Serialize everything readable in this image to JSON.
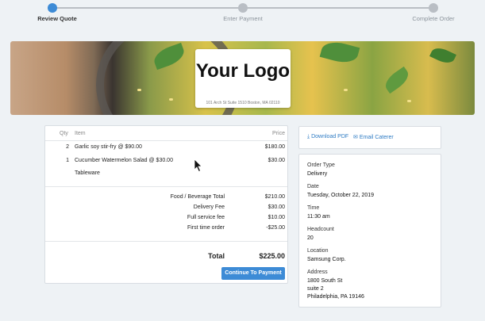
{
  "stepper": {
    "steps": [
      {
        "label": "Review Quote"
      },
      {
        "label": "Enter Payment"
      },
      {
        "label": "Complete Order"
      }
    ]
  },
  "hero": {
    "logo_text": "Your Logo",
    "address": "101 Arch St Suite 1510 Boston, MA 02110"
  },
  "quote": {
    "headers": {
      "qty": "Qty",
      "item": "Item",
      "price": "Price"
    },
    "items": [
      {
        "qty": "2",
        "item": "Garlic soy stir-fry @ $90.00",
        "price": "$180.00"
      },
      {
        "qty": "1",
        "item": "Cucumber Watermelon Salad @ $30.00",
        "price": "$30.00"
      },
      {
        "qty": "",
        "item": "Tableware",
        "price": ""
      }
    ],
    "fees": [
      {
        "label": "Food / Beverage Total",
        "value": "$210.00"
      },
      {
        "label": "Delivery Fee",
        "value": "$30.00"
      },
      {
        "label": "Full service fee",
        "value": "$10.00"
      },
      {
        "label": "First time order",
        "value": "-$25.00"
      }
    ],
    "total_label": "Total",
    "total_value": "$225.00",
    "continue_label": "Continue To Payment"
  },
  "actions": {
    "download_label": "Download PDF",
    "email_label": "Email Caterer"
  },
  "details": {
    "order_type": {
      "label": "Order Type",
      "value": "Delivery"
    },
    "date": {
      "label": "Date",
      "value": "Tuesday, October 22, 2019"
    },
    "time": {
      "label": "Time",
      "value": "11:30 am"
    },
    "headcount": {
      "label": "Headcount",
      "value": "20"
    },
    "location": {
      "label": "Location",
      "value": "Samsung Corp."
    },
    "address": {
      "label": "Address",
      "line1": "1800 South St",
      "line2": "suite 2",
      "line3": "Philadelphia, PA 19146"
    }
  },
  "colors": {
    "accent": "#3d8bd6",
    "link": "#2f7cc4",
    "step_inactive": "#b9bec4"
  }
}
